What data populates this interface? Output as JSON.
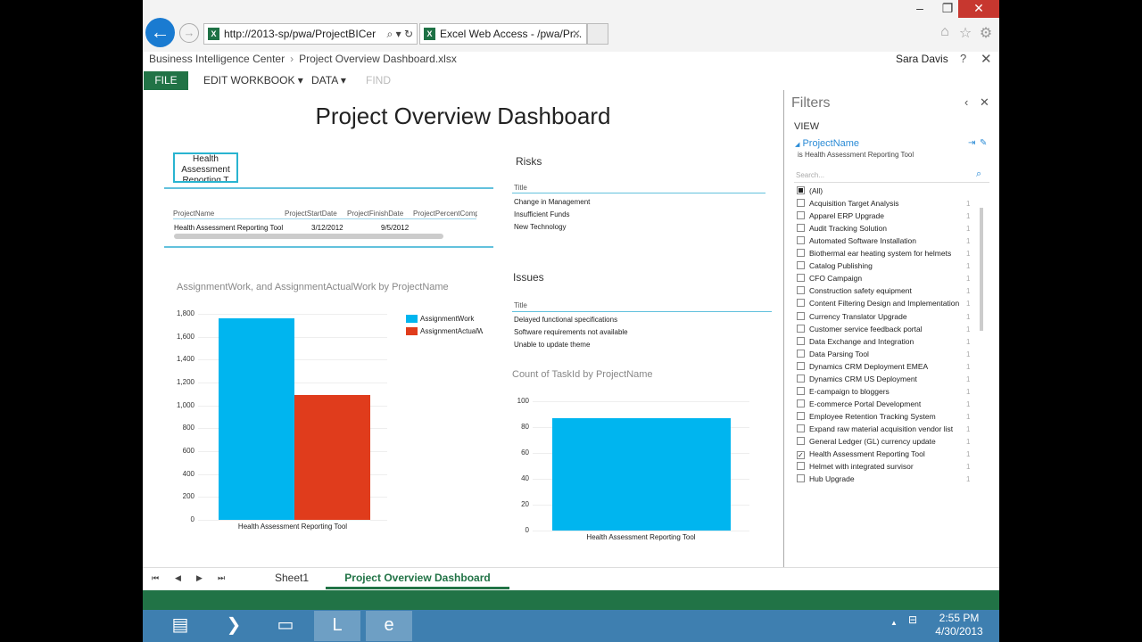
{
  "browser": {
    "address": "http://2013-sp/pwa/ProjectBICer",
    "tab_title": "Excel Web Access - /pwa/Pr...",
    "window_controls": [
      "–",
      "❐",
      "✕"
    ]
  },
  "header": {
    "breadcrumb": [
      "Business Intelligence Center",
      "Project Overview Dashboard.xlsx"
    ],
    "user": "Sara Davis",
    "help": "?",
    "close": "✕"
  },
  "ribbon": {
    "file": "FILE",
    "edit_workbook": "EDIT WORKBOOK ▾",
    "data": "DATA ▾",
    "find": "FIND"
  },
  "dashboard": {
    "title": "Project Overview Dashboard",
    "slicer_text": "Health Assessment Reporting T",
    "pivot": {
      "headers": [
        "ProjectName",
        "ProjectStartDate",
        "ProjectFinishDate",
        "ProjectPercentComp"
      ],
      "row": [
        "Health Assessment Reporting Tool",
        "3/12/2012",
        "9/5/2012"
      ]
    },
    "risks": {
      "title": "Risks",
      "column": "Title",
      "items": [
        "Change in Management",
        "Insufficient Funds",
        "New Technology"
      ]
    },
    "issues": {
      "title": "Issues",
      "column": "Title",
      "items": [
        "Delayed functional specifications",
        "Software requirements not available",
        "Unable to update theme"
      ]
    }
  },
  "chart_data": [
    {
      "type": "bar",
      "title": "AssignmentWork, and AssignmentActualWork by ProjectName",
      "categories": [
        "Health Assessment Reporting Tool"
      ],
      "series": [
        {
          "name": "AssignmentWork",
          "values": [
            1760
          ],
          "color": "#00b5ef"
        },
        {
          "name": "AssignmentActualW",
          "values": [
            1090
          ],
          "color": "#e03c1c"
        }
      ],
      "yticks": [
        "1,800",
        "1,600",
        "1,400",
        "1,200",
        "1,000",
        "800",
        "600",
        "400",
        "200",
        "0"
      ],
      "ylim": [
        0,
        1800
      ],
      "legend": "right"
    },
    {
      "type": "bar",
      "title": "Count of TaskId by ProjectName",
      "categories": [
        "Health Assessment Reporting Tool"
      ],
      "series": [
        {
          "values": [
            87
          ],
          "color": "#00b5ef"
        }
      ],
      "yticks": [
        "100",
        "80",
        "60",
        "40",
        "20",
        "0"
      ],
      "ylim": [
        0,
        100
      ]
    }
  ],
  "filters": {
    "title": "Filters",
    "view": "VIEW",
    "field": "ProjectName",
    "condition": "is Health Assessment Reporting Tool",
    "search_placeholder": "Search...",
    "items": [
      {
        "label": "(All)",
        "count": "",
        "state": "partial"
      },
      {
        "label": "Acquisition Target Analysis",
        "count": "1",
        "state": "off"
      },
      {
        "label": "Apparel ERP Upgrade",
        "count": "1",
        "state": "off"
      },
      {
        "label": "Audit Tracking Solution",
        "count": "1",
        "state": "off"
      },
      {
        "label": "Automated Software Installation",
        "count": "1",
        "state": "off"
      },
      {
        "label": "Biothermal ear heating system for helmets",
        "count": "1",
        "state": "off"
      },
      {
        "label": "Catalog Publishing",
        "count": "1",
        "state": "off"
      },
      {
        "label": "CFO Campaign",
        "count": "1",
        "state": "off"
      },
      {
        "label": "Construction safety equipment",
        "count": "1",
        "state": "off"
      },
      {
        "label": "Content Filtering Design and Implementation",
        "count": "1",
        "state": "off"
      },
      {
        "label": "Currency Translator Upgrade",
        "count": "1",
        "state": "off"
      },
      {
        "label": "Customer service feedback portal",
        "count": "1",
        "state": "off"
      },
      {
        "label": "Data Exchange and Integration",
        "count": "1",
        "state": "off"
      },
      {
        "label": "Data Parsing Tool",
        "count": "1",
        "state": "off"
      },
      {
        "label": "Dynamics CRM Deployment EMEA",
        "count": "1",
        "state": "off"
      },
      {
        "label": "Dynamics CRM US Deployment",
        "count": "1",
        "state": "off"
      },
      {
        "label": "E-campaign to bloggers",
        "count": "1",
        "state": "off"
      },
      {
        "label": "E-commerce Portal Development",
        "count": "1",
        "state": "off"
      },
      {
        "label": "Employee Retention Tracking System",
        "count": "1",
        "state": "off"
      },
      {
        "label": "Expand raw material acquisition vendor list",
        "count": "1",
        "state": "off"
      },
      {
        "label": "General Ledger (GL) currency update",
        "count": "1",
        "state": "off"
      },
      {
        "label": "Health Assessment Reporting Tool",
        "count": "1",
        "state": "on"
      },
      {
        "label": "Helmet with integrated survisor",
        "count": "1",
        "state": "off"
      },
      {
        "label": "Hub Upgrade",
        "count": "1",
        "state": "off"
      }
    ]
  },
  "sheet_tabs": {
    "nav": [
      "⏮",
      "◀",
      "▶",
      "⏭"
    ],
    "tabs": [
      "Sheet1",
      "Project Overview Dashboard"
    ]
  },
  "taskbar": {
    "time": "2:55 PM",
    "date": "4/30/2013"
  }
}
